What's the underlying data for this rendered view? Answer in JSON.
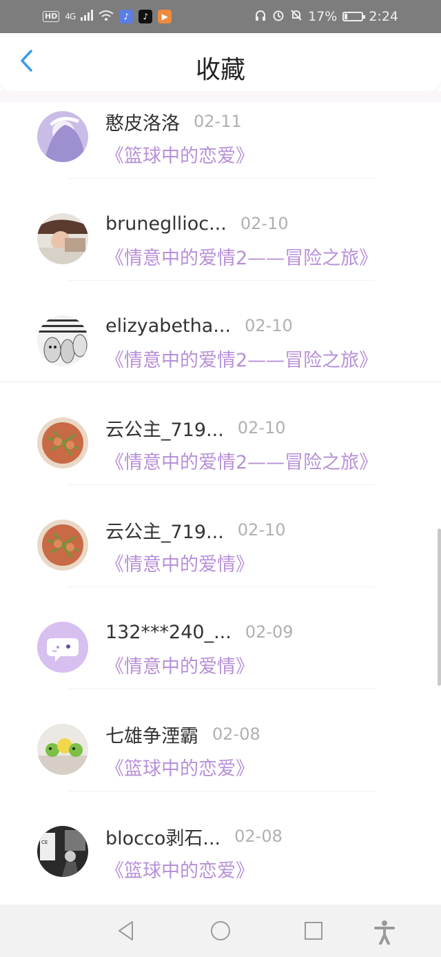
{
  "status_bar": {
    "hd": "HD",
    "network": "4G",
    "battery": "17%",
    "battery_level": 0.17,
    "time": "2:24"
  },
  "header": {
    "title": "收藏"
  },
  "colors": {
    "accent_blue": "#3b9be7",
    "book_purple": "#b790d8",
    "status_gray": "#7d7d7d"
  },
  "items": [
    {
      "name": "憨皮洛洛",
      "date": "02-11",
      "book": "《篮球中的恋爱》",
      "avatar": "anime-girl-avatar"
    },
    {
      "name": "brunegllioc...",
      "date": "02-10",
      "book": "《情意中的爱情2——冒险之旅》",
      "avatar": "child-photo-avatar"
    },
    {
      "name": "elizyabetha...",
      "date": "02-10",
      "book": "《情意中的爱情2——冒险之旅》",
      "avatar": "cartoon-faces-avatar"
    },
    {
      "name": "云公主_719...",
      "date": "02-10",
      "book": "《情意中的爱情2——冒险之旅》",
      "avatar": "food-photo-avatar"
    },
    {
      "name": "云公主_719...",
      "date": "02-10",
      "book": "《情意中的爱情》",
      "avatar": "food-photo-avatar"
    },
    {
      "name": "132***240_...",
      "date": "02-09",
      "book": "《情意中的爱情》",
      "avatar": "default-chat-avatar"
    },
    {
      "name": "七雄争湮霸",
      "date": "02-08",
      "book": "《篮球中的恋爱》",
      "avatar": "toys-photo-avatar"
    },
    {
      "name": "blocco剥石...",
      "date": "02-08",
      "book": "《篮球中的恋爱》",
      "avatar": "bw-photo-avatar"
    }
  ]
}
